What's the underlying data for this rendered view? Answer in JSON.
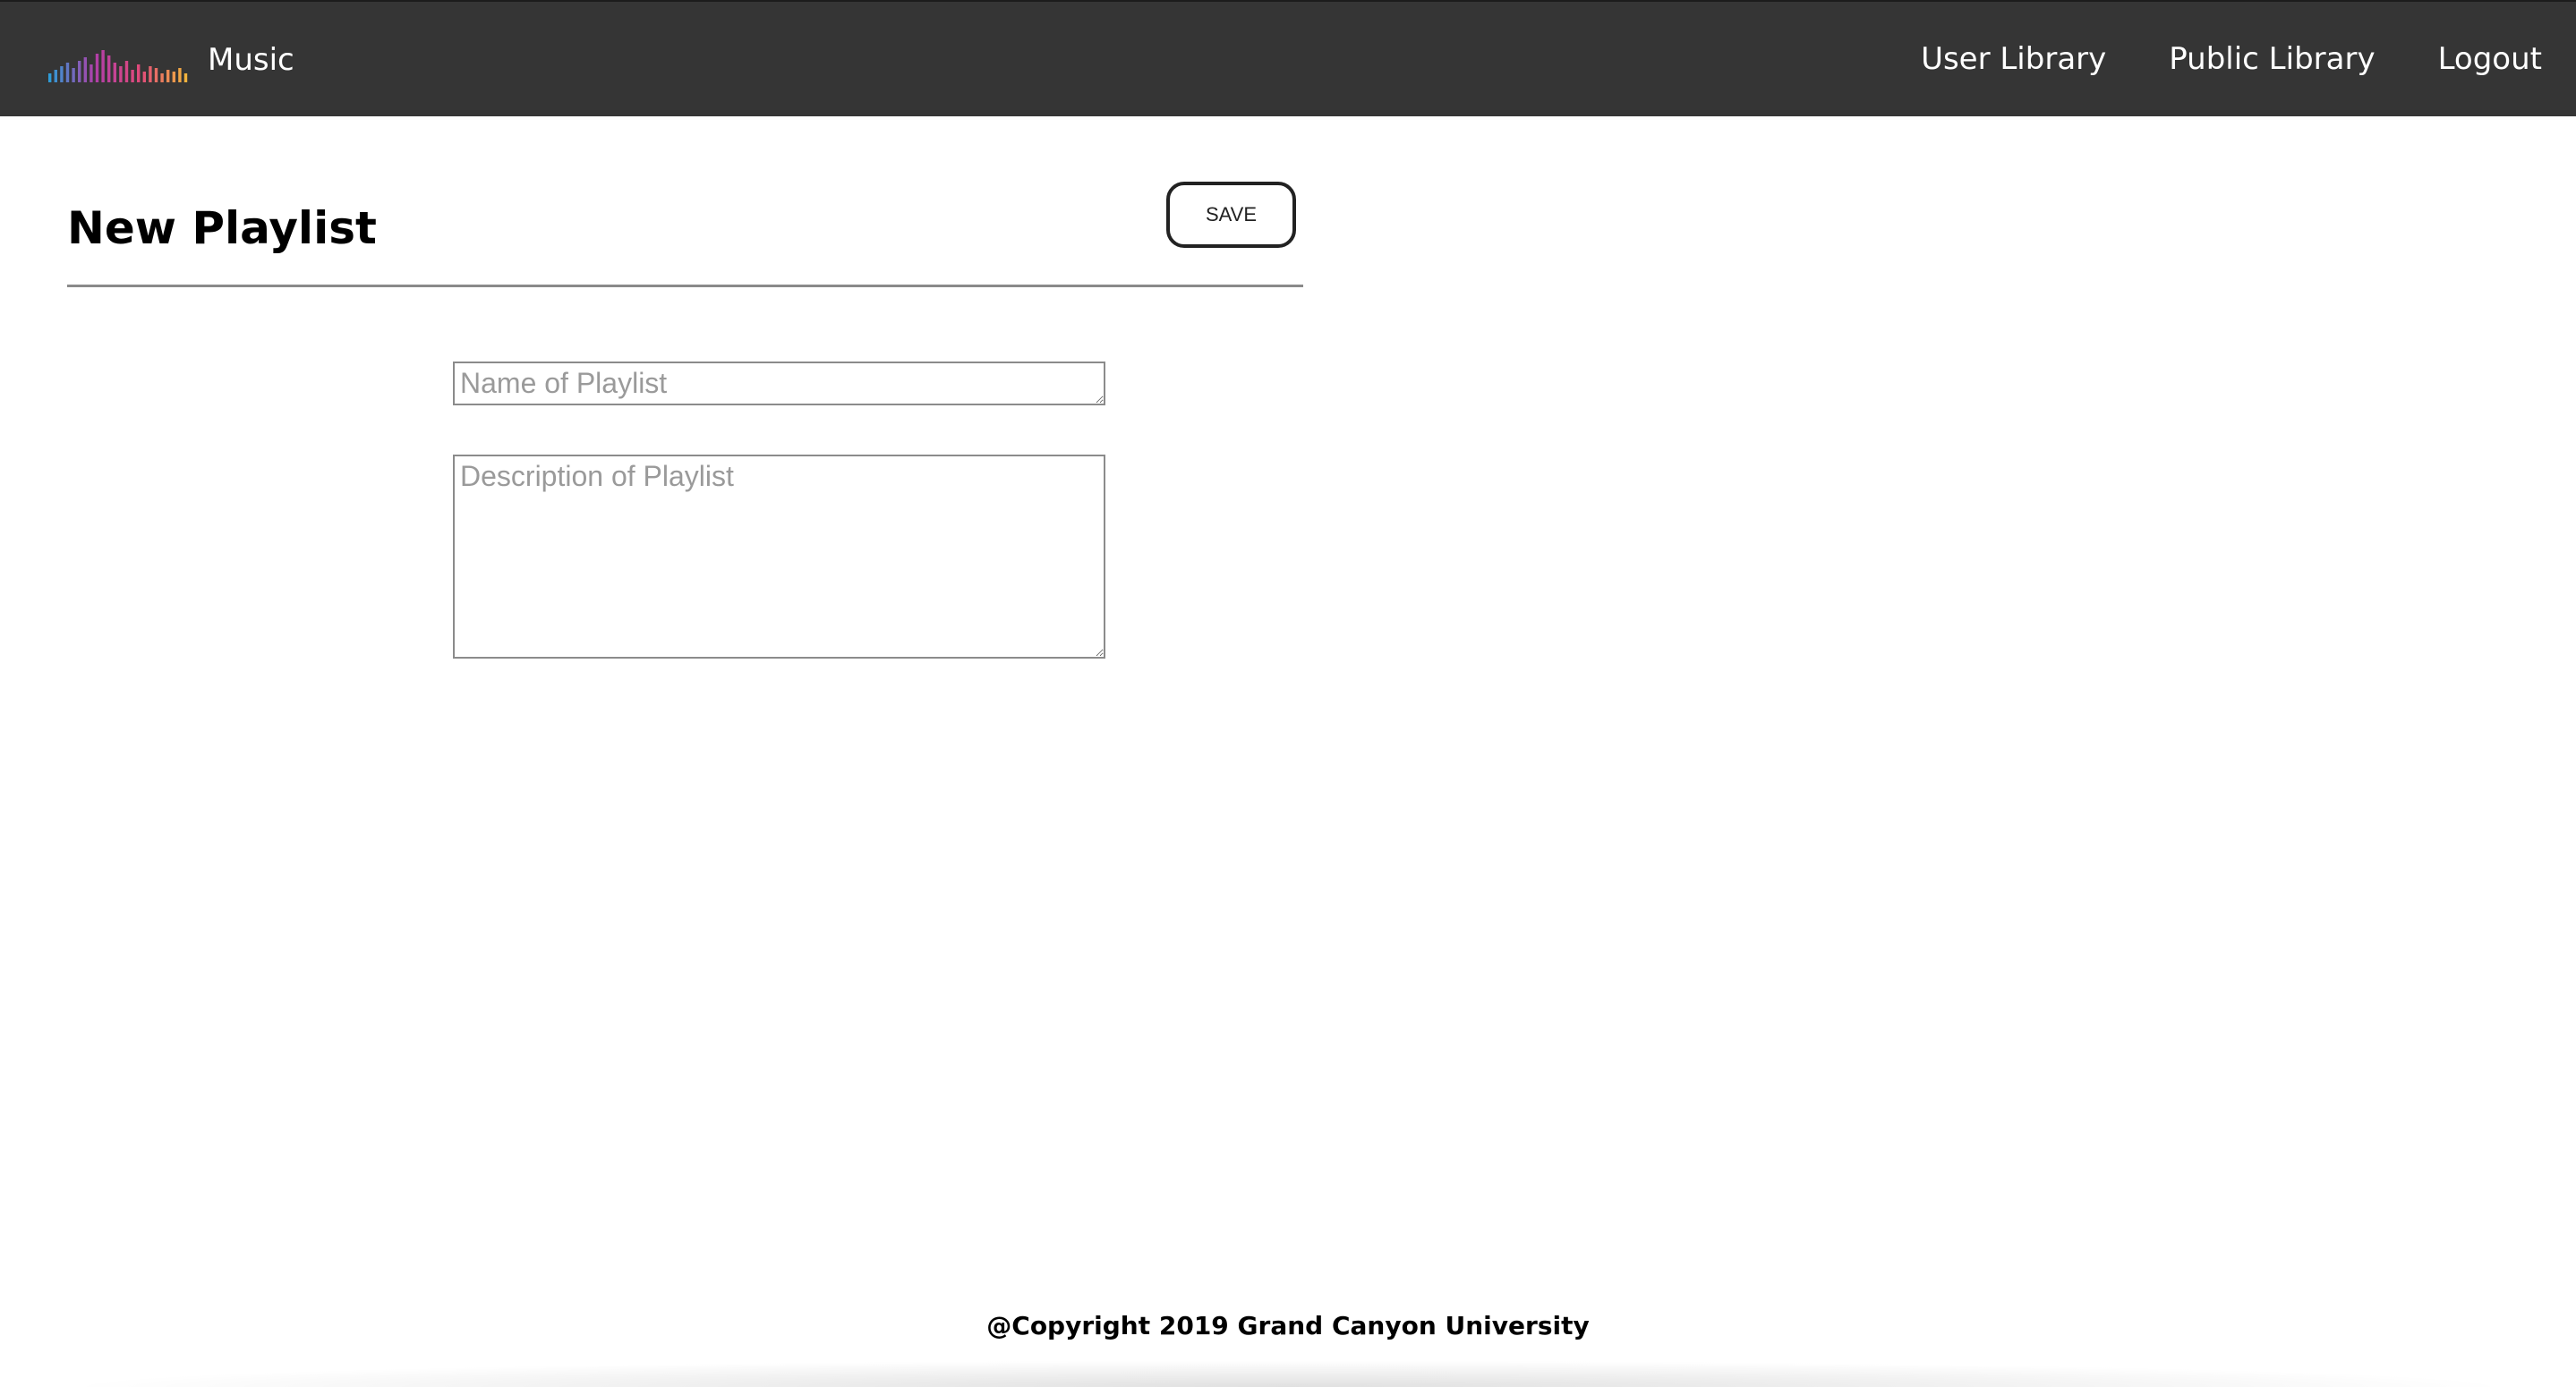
{
  "navbar": {
    "brand": "Music",
    "links": [
      "User Library",
      "Public Library",
      "Logout"
    ]
  },
  "main": {
    "title": "New Playlist",
    "save_label": "SAVE",
    "name_placeholder": "Name of Playlist",
    "description_placeholder": "Description of Playlist"
  },
  "footer": {
    "text": "@Copyright 2019 Grand Canyon University"
  },
  "colors": {
    "navbar_bg": "#353535",
    "logo_gradient": [
      "#2e9bd6",
      "#b03ea8",
      "#e24a7a",
      "#f2b33d"
    ]
  }
}
